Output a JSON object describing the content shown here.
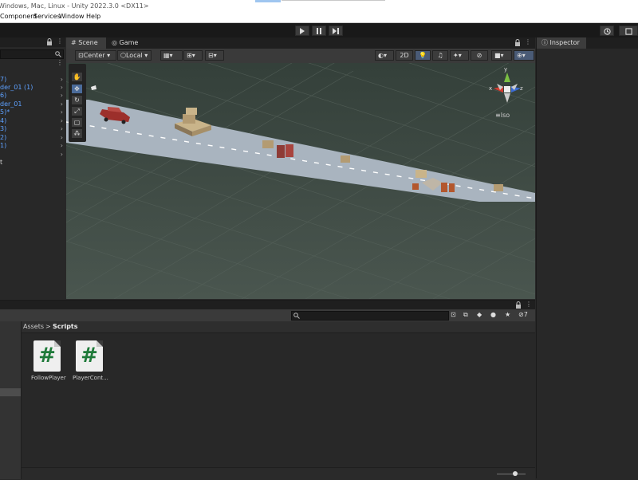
{
  "window": {
    "title": "Windows, Mac, Linux - Unity 2022.3.0 <DX11>"
  },
  "menu": {
    "items": [
      "Component",
      "Services",
      "Window",
      "Help"
    ]
  },
  "toolbar": {
    "play_icon": "play-icon",
    "pause_icon": "pause-icon",
    "step_icon": "step-icon",
    "history_icon": "history-icon"
  },
  "hierarchy": {
    "items": [
      "7)",
      "der_01 (1)",
      "6)",
      "der_01",
      "5)*",
      "4)",
      "3)",
      "2)",
      "1)",
      "",
      "t"
    ]
  },
  "scene_tabs": {
    "scene": "Scene",
    "game": "Game"
  },
  "scene_toolbar": {
    "pivot": "Center",
    "space": "Local",
    "mode_2d": "2D"
  },
  "gizmo": {
    "x": "x",
    "y": "y",
    "z": "z",
    "projection": "Iso"
  },
  "inspector": {
    "tab": "Inspector"
  },
  "project": {
    "breadcrumb_root": "Assets",
    "breadcrumb_sep": ">",
    "breadcrumb_current": "Scripts",
    "hidden_count": "7",
    "scripts": [
      {
        "name": "FollowPlayer"
      },
      {
        "name": "PlayerCont..."
      }
    ]
  },
  "colors": {
    "scene_bg": "#3e4a44",
    "road": "#a9b4bf",
    "accent_blue": "#4b6b9a",
    "script_green": "#1f7a3a"
  }
}
